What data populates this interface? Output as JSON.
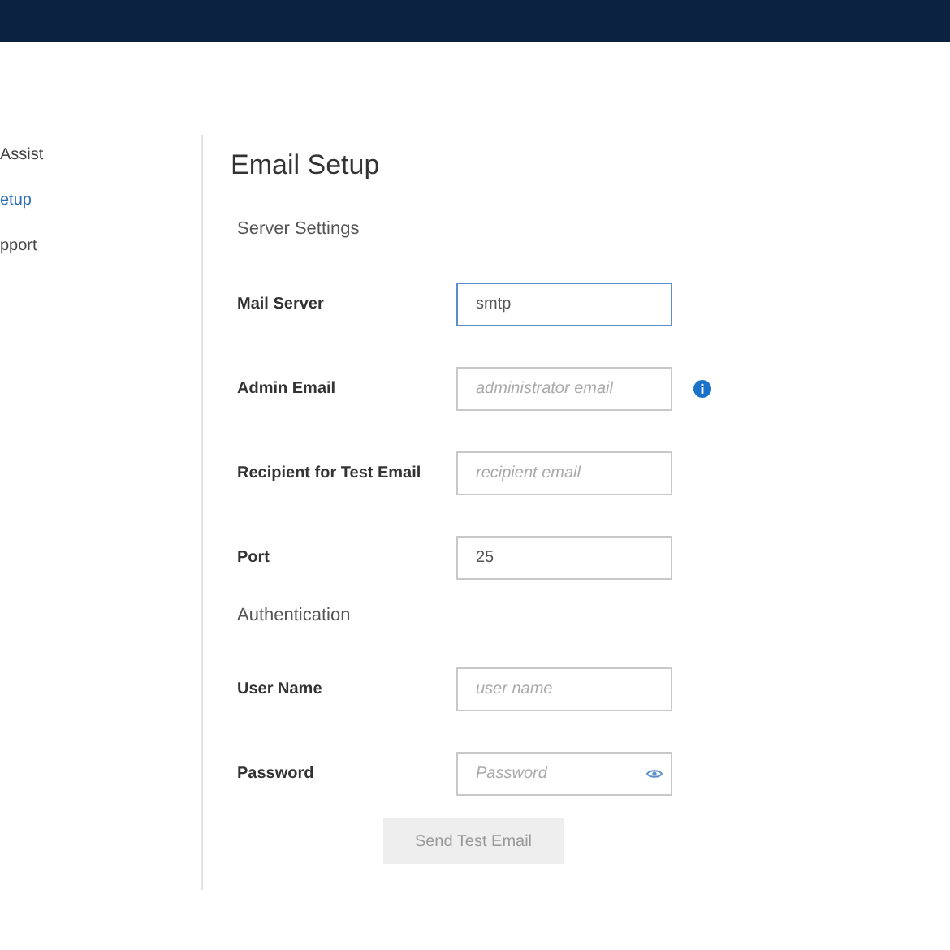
{
  "sidebar": {
    "items": [
      {
        "label": "Assist",
        "selected": false
      },
      {
        "label": "etup",
        "selected": true
      },
      {
        "label": "pport",
        "selected": false
      }
    ]
  },
  "page_title": "Email Setup",
  "sections": [
    {
      "title": "Server Settings",
      "fields": [
        {
          "label": "Mail Server",
          "kind": "text",
          "value": "smtp",
          "focused": true,
          "info": false
        },
        {
          "label": "Admin Email",
          "kind": "text",
          "placeholder": "administrator email",
          "focused": false,
          "info": true
        },
        {
          "label": "Recipient for Test Email",
          "kind": "text",
          "placeholder": "recipient email",
          "focused": false,
          "info": false
        },
        {
          "label": "Port",
          "kind": "text",
          "value": "25",
          "focused": false,
          "info": false
        }
      ]
    },
    {
      "title": "Authentication",
      "fields": [
        {
          "label": "User Name",
          "kind": "text",
          "placeholder": "user name",
          "focused": false,
          "info": false
        },
        {
          "label": "Password",
          "kind": "password",
          "placeholder": "Password",
          "focused": false,
          "info": false
        }
      ]
    }
  ],
  "send_button": {
    "label": "Send Test Email",
    "disabled": true
  }
}
